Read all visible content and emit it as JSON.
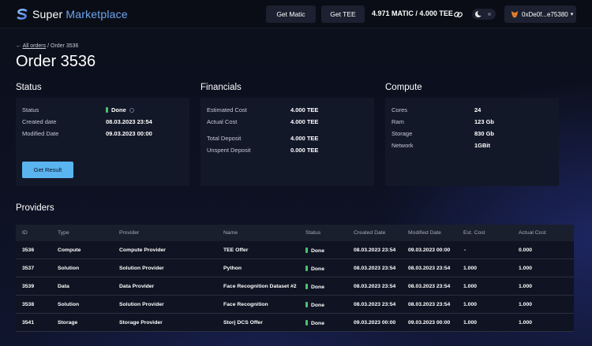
{
  "app": {
    "logo_word1": "Super",
    "logo_word2": "Marketplace",
    "accent_color": "#5ab4f0",
    "logo_color": "#6da7f0",
    "status_color": "#4cc26e"
  },
  "header": {
    "get_matic_label": "Get Matic",
    "get_tee_label": "Get TEE",
    "balance": "4.971 MATIC / 4.000 TEE",
    "wallet_address": "0xDe0f...e75380",
    "wallet_caret": "▾"
  },
  "breadcrumb": {
    "back_arrow": "←",
    "link": "All orders",
    "separator": "/",
    "current": "Order 3536"
  },
  "page_title": "Order 3536",
  "status": {
    "title": "Status",
    "rows": [
      {
        "label": "Status",
        "value": "Done"
      },
      {
        "label": "Created date",
        "value": "08.03.2023 23:54"
      },
      {
        "label": "Modified Date",
        "value": "09.03.2023 00:00"
      }
    ],
    "button_label": "Get Result"
  },
  "financials": {
    "title": "Financials",
    "rows": [
      {
        "label": "Estimated Cost",
        "value": "4.000 TEE"
      },
      {
        "label": "Actual Cost",
        "value": "4.000 TEE"
      },
      {
        "label": "Total Deposit",
        "value": "4.000 TEE"
      },
      {
        "label": "Unspent Deposit",
        "value": "0.000 TEE"
      }
    ]
  },
  "compute": {
    "title": "Compute",
    "rows": [
      {
        "label": "Cores",
        "value": "24"
      },
      {
        "label": "Ram",
        "value": "123 Gb"
      },
      {
        "label": "Storage",
        "value": "830 Gb"
      },
      {
        "label": "Network",
        "value": "1GBit"
      }
    ]
  },
  "providers": {
    "title": "Providers",
    "columns": [
      "ID",
      "Type",
      "Provider",
      "Name",
      "Status",
      "Created Date",
      "Modified Date",
      "Est. Cost",
      "Actual Cost"
    ],
    "rows": [
      [
        "3536",
        "Compute",
        "Compute Provider",
        "TEE Offer",
        "Done",
        "08.03.2023 23:54",
        "09.03.2023 00:00",
        "-",
        "0.000"
      ],
      [
        "3537",
        "Solution",
        "Solution Provider",
        "Python",
        "Done",
        "08.03.2023 23:54",
        "08.03.2023 23:54",
        "1.000",
        "1.000"
      ],
      [
        "3539",
        "Data",
        "Data Provider",
        "Face Recognition Dataset #2",
        "Done",
        "08.03.2023 23:54",
        "08.03.2023 23:54",
        "1.000",
        "1.000"
      ],
      [
        "3538",
        "Solution",
        "Solution Provider",
        "Face Recognition",
        "Done",
        "08.03.2023 23:54",
        "08.03.2023 23:54",
        "1.000",
        "1.000"
      ],
      [
        "3541",
        "Storage",
        "Storage Provider",
        "Storj DCS Offer",
        "Done",
        "09.03.2023 00:00",
        "09.03.2023 00:00",
        "1.000",
        "1.000"
      ]
    ]
  }
}
